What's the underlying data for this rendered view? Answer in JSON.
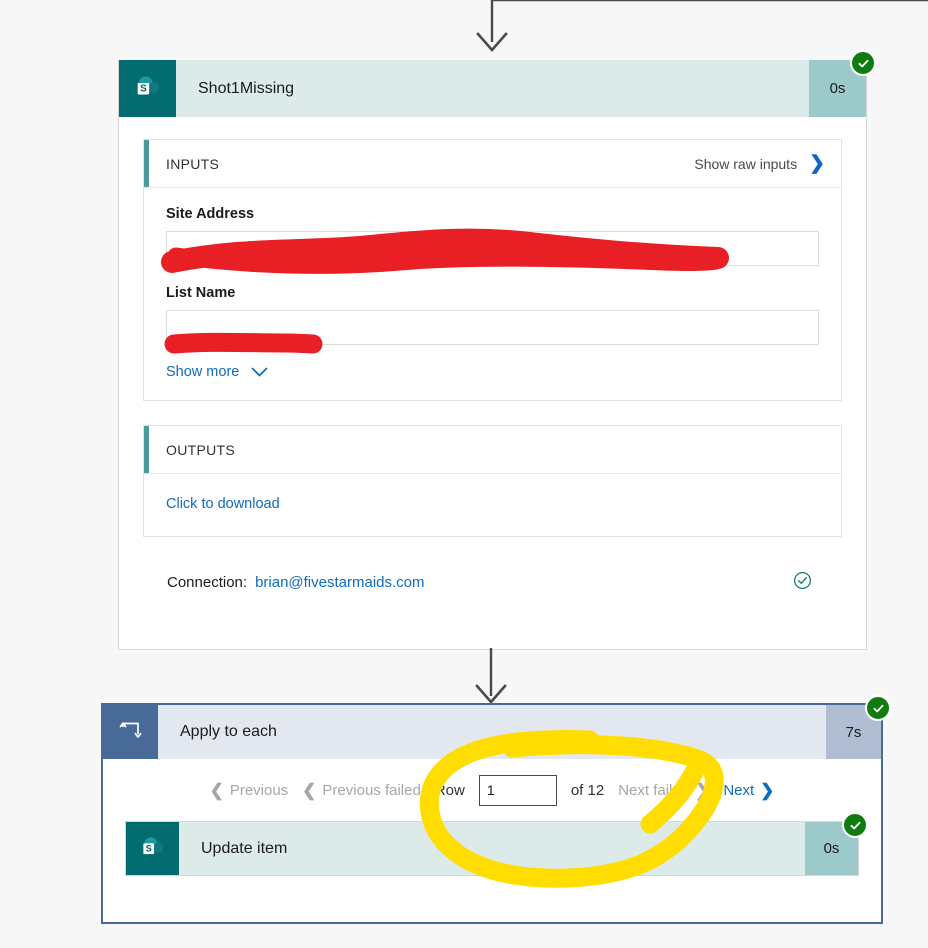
{
  "flow": {
    "top_action": {
      "title": "Shot1Missing",
      "icon": "sharepoint-icon",
      "duration": "0s",
      "status": "succeeded",
      "inputs_panel": {
        "heading": "INPUTS",
        "raw_link": "Show raw inputs",
        "raw_link_icon": "chevron-right-icon",
        "fields": [
          {
            "label": "Site Address",
            "value": "",
            "redacted": true
          },
          {
            "label": "List Name",
            "value": "",
            "redacted": true
          }
        ],
        "show_more": "Show more",
        "show_more_icon": "chevron-down-icon"
      },
      "outputs_panel": {
        "heading": "OUTPUTS",
        "download_link": "Click to download"
      },
      "connection": {
        "label": "Connection:",
        "value": "brian@fivestarmaids.com",
        "status_icon": "check-circle-icon"
      }
    },
    "scope_action": {
      "title": "Apply to each",
      "icon": "loop-repeat-icon",
      "duration": "7s",
      "status": "succeeded",
      "pager": {
        "previous": "Previous",
        "previous_failed": "Previous failed",
        "row_label": "Row",
        "row_value": "1",
        "of_label": "of 12",
        "next_failed": "Next failed",
        "next": "Next",
        "prev_icon": "chevron-left-icon",
        "next_icon": "chevron-right-icon"
      },
      "nested_action": {
        "title": "Update item",
        "icon": "sharepoint-icon",
        "duration": "0s",
        "status": "succeeded"
      }
    }
  },
  "annotations": {
    "redaction_color": "#e81f25",
    "highlight_color": "#ffdd00",
    "redaction_note": "red marker over site address and list name",
    "highlight_note": "yellow circle around row pagination"
  },
  "colors": {
    "sharepoint_teal": "#036c70",
    "action_header": "#dcebea",
    "duration_badge": "#9cc9c9",
    "scope_blue": "#486a96",
    "scope_header": "#e3e8f0",
    "link_blue": "#0f6cbd",
    "success_green": "#107c10",
    "page_background": "#f7f7f7"
  }
}
